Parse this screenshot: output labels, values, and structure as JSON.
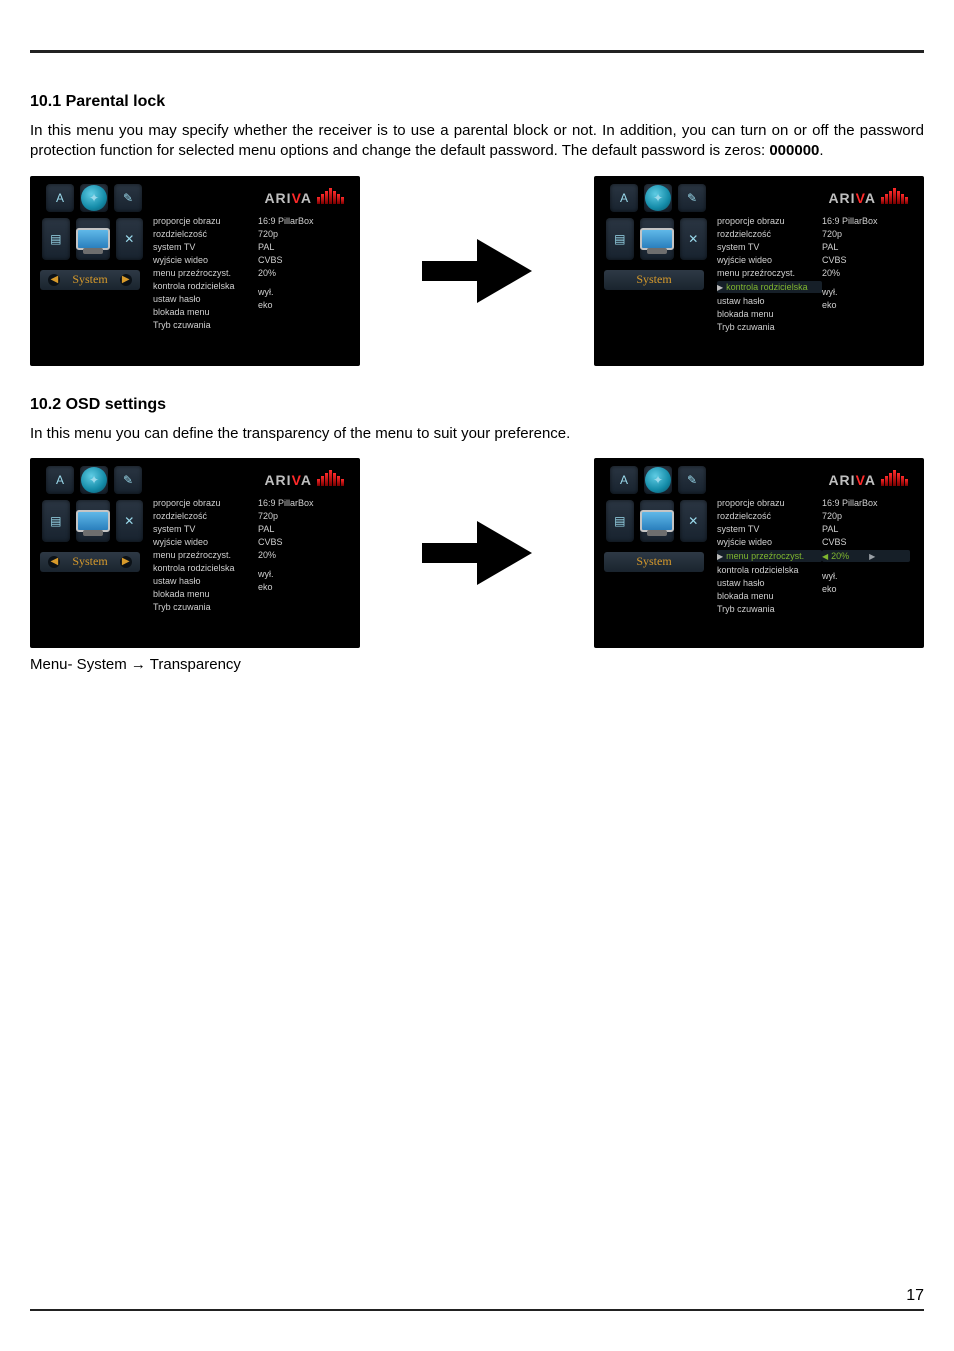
{
  "page_number": "17",
  "section1": {
    "heading": "10.1 Parental lock",
    "para_prefix": "In this menu you may specify whether the receiver is to use a parental block or not. In addition, you can turn on or off the password protection function for selected menu options and change the default password. The default password is zeros: ",
    "default_pw": "000000",
    "para_suffix": "."
  },
  "section2": {
    "heading": "10.2 OSD settings",
    "para": "In this menu you can define the transparency of the menu to suit your preference.",
    "breadcrumb": "Menu- System → Transparency"
  },
  "menu": {
    "brand": "ARIVA",
    "system_label": "System",
    "labels": [
      "proporcje obrazu",
      "rozdzielczość",
      "system TV",
      "wyjście wideo",
      "menu przeźroczyst.",
      "kontrola rodzicielska",
      "ustaw hasło",
      "blokada menu",
      "Tryb czuwania"
    ],
    "values": {
      "pillar": "16:9 PillarBox",
      "res": "720p",
      "tv": "PAL",
      "out": "CVBS",
      "osd": "20%",
      "empty": "",
      "lock": "wył.",
      "standby": "eko"
    }
  }
}
